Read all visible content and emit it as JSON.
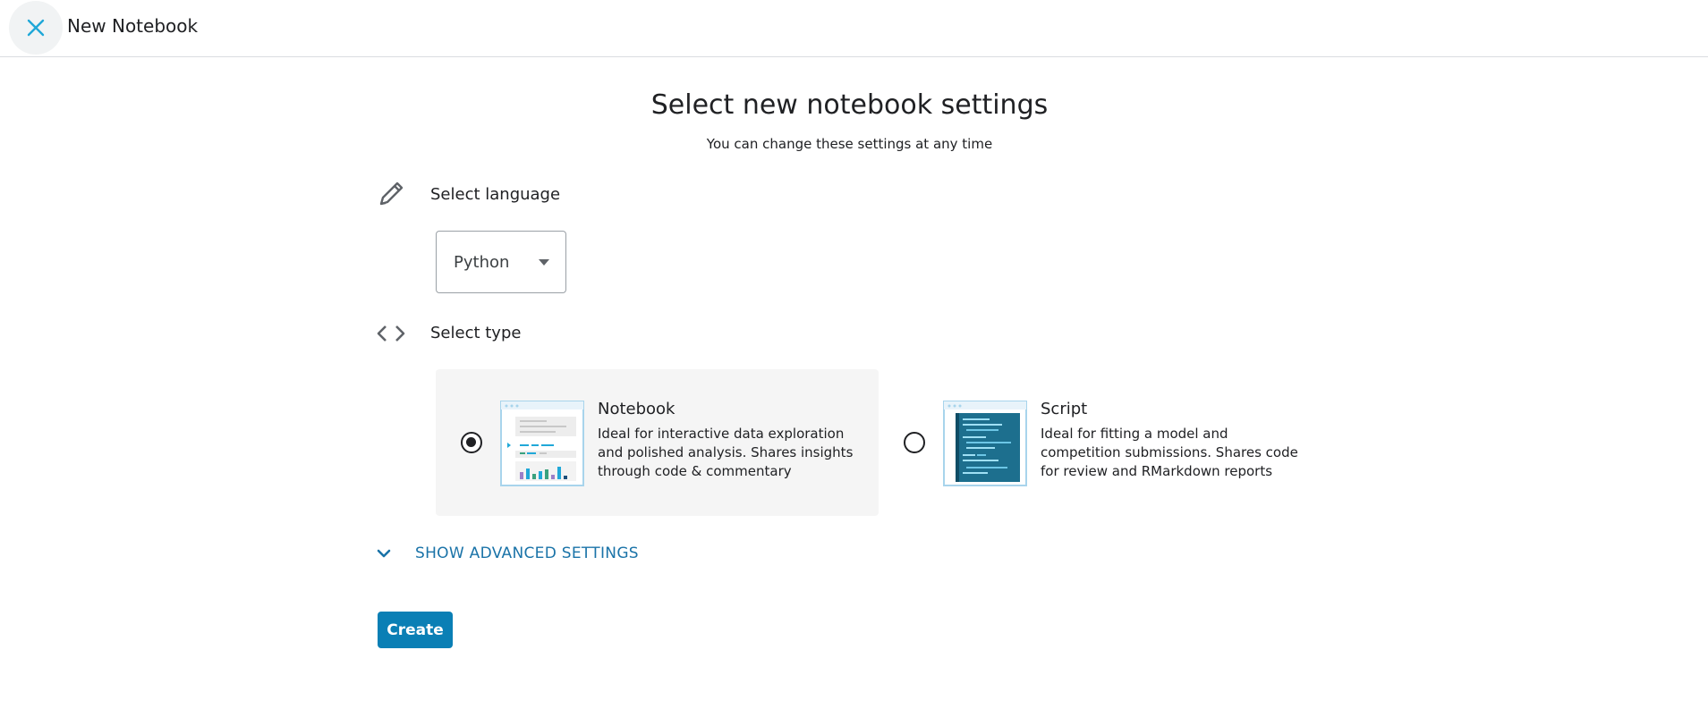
{
  "topbar": {
    "title": "New Notebook"
  },
  "page": {
    "heading": "Select new notebook settings",
    "subheading": "You can change these settings at any time"
  },
  "language": {
    "label": "Select language",
    "selected": "Python"
  },
  "type": {
    "label": "Select type",
    "options": [
      {
        "title": "Notebook",
        "description": "Ideal for interactive data exploration and polished analysis. Shares insights through code & commentary",
        "selected": true
      },
      {
        "title": "Script",
        "description": "Ideal for fitting a model and competition submissions. Shares code for review and RMarkdown reports",
        "selected": false
      }
    ]
  },
  "advanced": {
    "label": "SHOW ADVANCED SETTINGS"
  },
  "actions": {
    "create_label": "Create"
  },
  "colors": {
    "accent": "#0a7fb5",
    "link": "#1a73a8",
    "close_icon": "#20a8d8"
  },
  "icons": {
    "close": "close-icon",
    "language": "pencil-icon",
    "type": "code-brackets-icon",
    "dropdown": "caret-down-icon",
    "advanced": "chevron-down-icon"
  }
}
